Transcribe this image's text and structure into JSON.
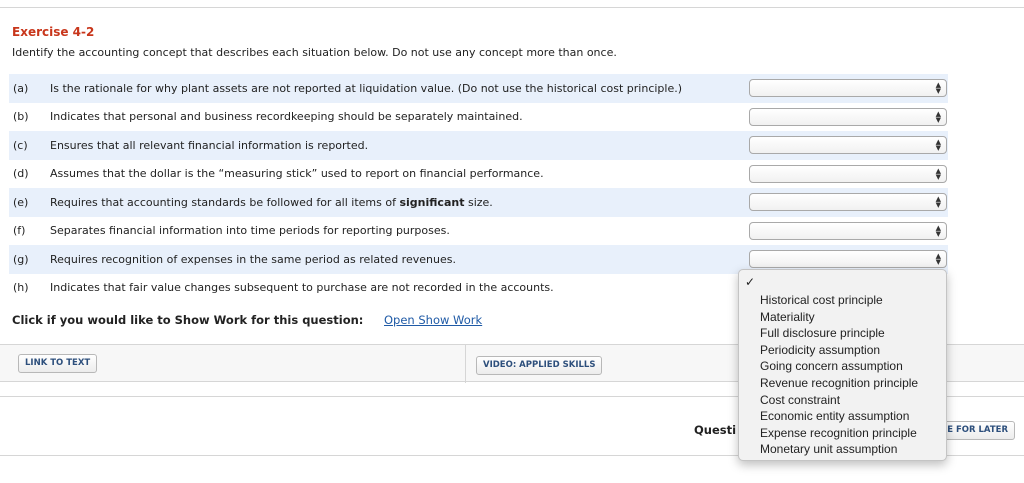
{
  "exercise": {
    "title": "Exercise 4-2",
    "instructions": "Identify the accounting concept that describes each situation below. Do not use any concept more than once."
  },
  "questions": [
    {
      "letter": "(a)",
      "text_before": "Is the rationale for why plant assets are not reported at liquidation value. (Do not use the historical cost principle.)",
      "bold": "",
      "text_after": "",
      "selected": ""
    },
    {
      "letter": "(b)",
      "text_before": "Indicates that personal and business recordkeeping should be separately maintained.",
      "bold": "",
      "text_after": "",
      "selected": ""
    },
    {
      "letter": "(c)",
      "text_before": "Ensures that all relevant financial information is reported.",
      "bold": "",
      "text_after": "",
      "selected": ""
    },
    {
      "letter": "(d)",
      "text_before": "Assumes that the dollar is the “measuring stick” used to report on financial performance.",
      "bold": "",
      "text_after": "",
      "selected": ""
    },
    {
      "letter": "(e)",
      "text_before": "Requires that accounting standards be followed for all items of ",
      "bold": "significant",
      "text_after": " size.",
      "selected": ""
    },
    {
      "letter": "(f)",
      "text_before": "Separates financial information into time periods for reporting purposes.",
      "bold": "",
      "text_after": "",
      "selected": ""
    },
    {
      "letter": "(g)",
      "text_before": "Requires recognition of expenses in the same period as related revenues.",
      "bold": "",
      "text_after": "",
      "selected": ""
    },
    {
      "letter": "(h)",
      "text_before": "Indicates that fair value changes subsequent to purchase are not recorded in the accounts.",
      "bold": "",
      "text_after": "",
      "selected": ""
    }
  ],
  "show_work": {
    "prompt": "Click if you would like to Show Work for this question:",
    "link": "Open Show Work"
  },
  "buttons": {
    "link_to_text": "LINK TO TEXT",
    "video": "VIDEO: APPLIED SKILLS",
    "save_later": "E FOR LATER"
  },
  "footer": {
    "question_label": "Questi"
  },
  "dropdown": {
    "checkmark": "✓",
    "options": [
      "Historical cost principle",
      "Materiality",
      "Full disclosure principle",
      "Periodicity assumption",
      "Going concern assumption",
      "Revenue recognition principle",
      "Cost constraint",
      "Economic entity assumption",
      "Expense recognition principle",
      "Monetary unit assumption"
    ]
  },
  "colors": {
    "title": "#c8361b",
    "row_shade": "#e8f0fb",
    "link": "#1f5aa6",
    "button_text": "#2d4f7c"
  },
  "icons": {
    "select_arrows": "up-down-arrows-icon",
    "checkmark": "checkmark-icon"
  }
}
